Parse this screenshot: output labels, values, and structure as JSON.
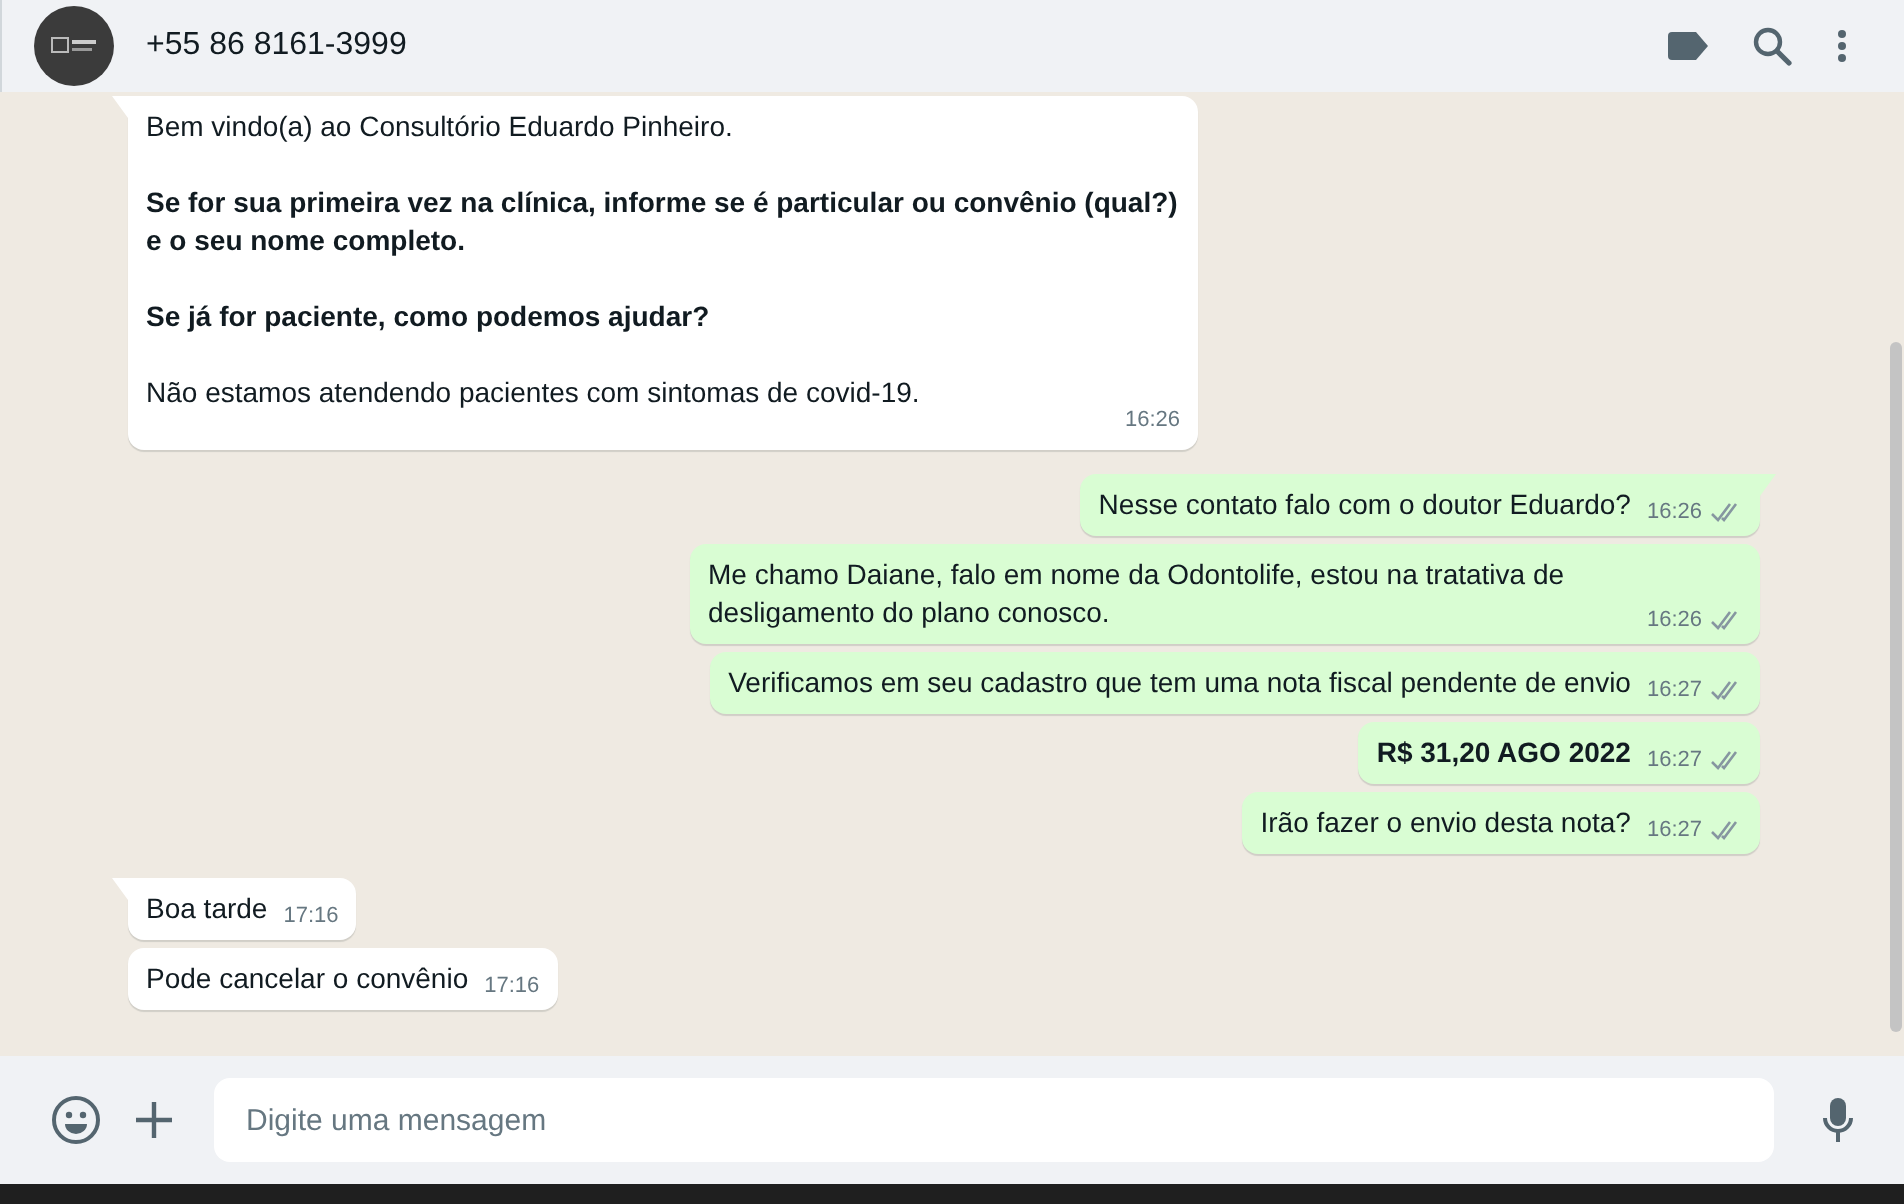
{
  "header": {
    "contact": "+55 86 8161-3999"
  },
  "messages": [
    {
      "kind": "incoming",
      "tail": true,
      "time": "16:26",
      "paragraphs": [
        {
          "text": "Bem vindo(a) ao Consultório Eduardo Pinheiro.",
          "bold": false
        },
        {
          "text": "Se for sua primeira vez na clínica, informe se é particular ou convênio (qual?) e o seu nome completo.",
          "bold": true
        },
        {
          "text": "Se já for paciente, como podemos ajudar?",
          "bold": true
        },
        {
          "text": "Não estamos atendendo pacientes com sintomas de covid-19.",
          "bold": false
        }
      ]
    },
    {
      "kind": "outgoing",
      "tail": true,
      "time": "16:26",
      "paragraphs": [
        {
          "text": "Nesse contato falo com o doutor Eduardo?",
          "bold": false
        }
      ]
    },
    {
      "kind": "outgoing",
      "tail": false,
      "time": "16:26",
      "paragraphs": [
        {
          "text": "Me chamo Daiane, falo em nome da Odontolife, estou na tratativa de desligamento do plano conosco.",
          "bold": false
        }
      ]
    },
    {
      "kind": "outgoing",
      "tail": false,
      "time": "16:27",
      "paragraphs": [
        {
          "text": "Verificamos em seu cadastro que tem uma nota fiscal pendente de envio",
          "bold": false
        }
      ]
    },
    {
      "kind": "outgoing",
      "tail": false,
      "time": "16:27",
      "paragraphs": [
        {
          "text": "R$ 31,20 AGO 2022",
          "bold": true
        }
      ]
    },
    {
      "kind": "outgoing",
      "tail": false,
      "time": "16:27",
      "paragraphs": [
        {
          "text": "Irão fazer o envio desta nota?",
          "bold": false
        }
      ]
    },
    {
      "kind": "incoming",
      "tail": true,
      "time": "17:16",
      "paragraphs": [
        {
          "text": "Boa tarde",
          "bold": false
        }
      ]
    },
    {
      "kind": "incoming",
      "tail": false,
      "time": "17:16",
      "paragraphs": [
        {
          "text": "Pode cancelar o convênio",
          "bold": false
        }
      ]
    }
  ],
  "composer": {
    "placeholder": "Digite uma mensagem"
  }
}
